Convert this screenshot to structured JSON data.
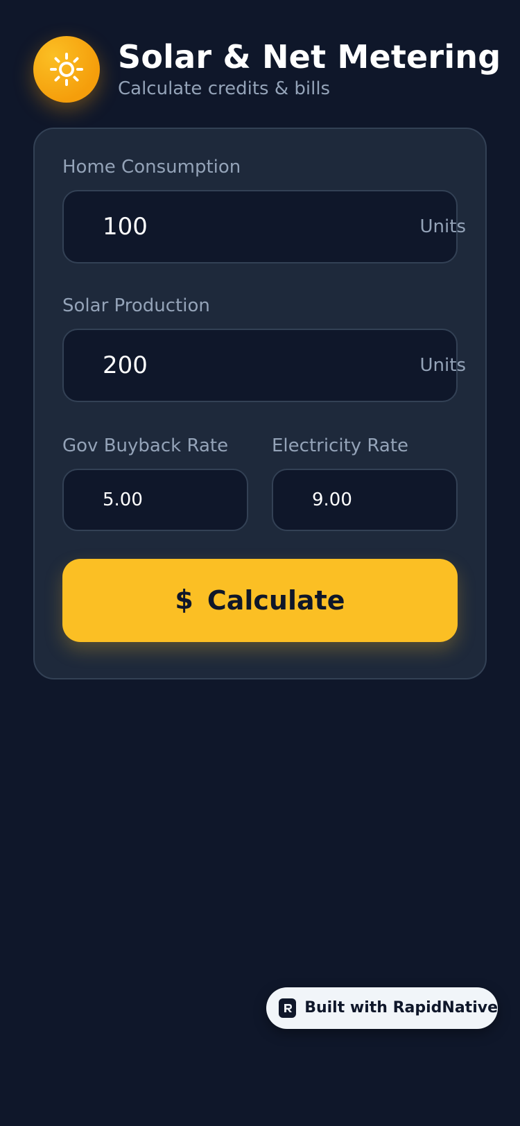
{
  "header": {
    "title": "Solar & Net Metering",
    "subtitle": "Calculate credits & bills",
    "icon": "sun-icon"
  },
  "form": {
    "home_consumption": {
      "label": "Home Consumption",
      "value": "100",
      "unit": "Units"
    },
    "solar_production": {
      "label": "Solar Production",
      "value": "200",
      "unit": "Units"
    },
    "gov_buyback_rate": {
      "label": "Gov Buyback Rate",
      "value": "5.00"
    },
    "electricity_rate": {
      "label": "Electricity Rate",
      "value": "9.00"
    },
    "calculate_button": {
      "icon": "dollar-icon",
      "label": "Calculate"
    }
  },
  "badge": {
    "text": "Built with RapidNative",
    "icon": "rapidnative-logo-icon"
  },
  "colors": {
    "background": "#0f172a",
    "card": "#1e293b",
    "border": "#334155",
    "muted_text": "#94a3b8",
    "accent": "#fbbf24",
    "accent_deep": "#f59e0b"
  }
}
